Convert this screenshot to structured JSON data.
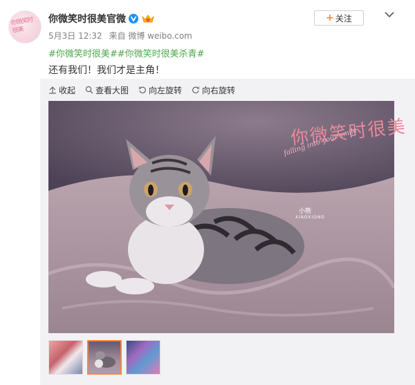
{
  "post": {
    "author": "你微笑时很美官微",
    "avatar_text": "你微笑时很美",
    "date": "5月3日 12:32",
    "source": "来自 微博 weibo.com",
    "hashtags": "#你微笑时很美##你微笑时很美杀青#",
    "text": "还有我们！我们才是主角！"
  },
  "follow": {
    "label": "关注",
    "plus": "+"
  },
  "toolbar": {
    "collapse": "收起",
    "view_large": "查看大图",
    "rotate_left": "向左旋转",
    "rotate_right": "向右旋转"
  },
  "photo_overlay": {
    "title": "你微笑时很美",
    "subtitle": "falling into your smile",
    "name_cn": "小熊",
    "name_en": "XIAOXIONG"
  },
  "thumbnails": [
    {
      "name": "thumbnail-1",
      "active": false
    },
    {
      "name": "thumbnail-2",
      "active": true
    },
    {
      "name": "thumbnail-3",
      "active": false
    }
  ],
  "colors": {
    "accent_orange": "#ff8140",
    "hashtag_green": "#4ca84c",
    "verified_blue": "#1e90ff"
  },
  "icons": {
    "verified": "verified-badge-icon",
    "vip": "vip-crown-icon",
    "menu": "chevron-down-icon",
    "collapse": "arrow-up-icon",
    "view_large": "magnifier-icon",
    "rotate_left": "rotate-left-icon",
    "rotate_right": "rotate-right-icon"
  }
}
